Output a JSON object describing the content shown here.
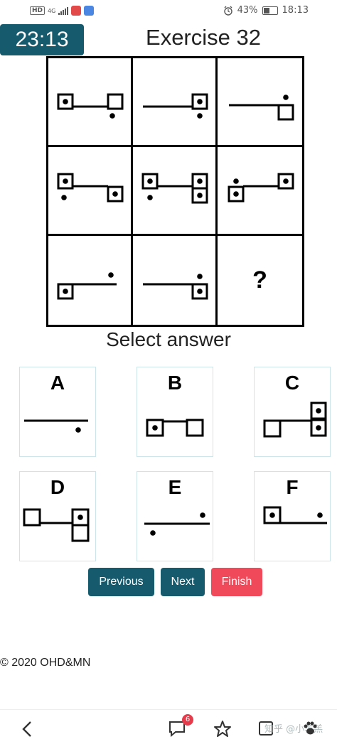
{
  "status_bar": {
    "network_badge": "HD",
    "network_type": "4G",
    "battery_text": "43%",
    "battery_level": 0.43,
    "time": "18:13"
  },
  "timer": "23:13",
  "title": "Exercise 32",
  "matrix": {
    "question_mark": "?"
  },
  "select_label": "Select answer",
  "answers": [
    {
      "letter": "A"
    },
    {
      "letter": "B"
    },
    {
      "letter": "C"
    },
    {
      "letter": "D"
    },
    {
      "letter": "E"
    },
    {
      "letter": "F"
    }
  ],
  "buttons": {
    "previous": "Previous",
    "next": "Next",
    "finish": "Finish"
  },
  "colors": {
    "primary": "#165a6e",
    "danger": "#f0495a",
    "answer_border": "#cde4ea"
  },
  "footer": {
    "copyright": "© 2020 OHD&MN"
  },
  "bottom_nav": {
    "comment_count": "6",
    "watermark": "知乎 @小羊羔"
  }
}
